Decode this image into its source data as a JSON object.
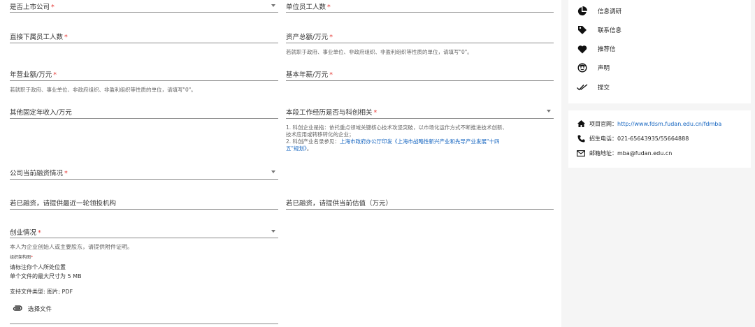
{
  "form": {
    "listed_company": {
      "label": "是否上市公司",
      "required": "*"
    },
    "unit_employees": {
      "label": "单位员工人数",
      "required": "*"
    },
    "direct_reports": {
      "label": "直接下属员工人数",
      "required": "*"
    },
    "total_assets": {
      "label": "资产总额/万元",
      "required": "*",
      "hint": "若就职于政府、事业单位、非政府组织、非盈利组织等性质的单位，请填写\"0\"。"
    },
    "annual_revenue": {
      "label": "年营业额/万元",
      "required": "*",
      "hint": "若就职于政府、事业单位、非政府组织、非盈利组织等性质的单位，请填写\"0\"。"
    },
    "base_salary": {
      "label": "基本年薪/万元",
      "required": "*"
    },
    "other_income": {
      "label": "其他固定年收入/万元"
    },
    "tech_related": {
      "label": "本段工作经历是否与科创相关",
      "required": "*",
      "hint_line1": "1. 科创企业是指：依托重点领域关键核心技术攻坚突破，以市场化运作方式不断推进技术创新、",
      "hint_line2": "技术应用或转移转化的企业；",
      "hint_line3_prefix": "2. 科创产业名录参见：",
      "hint_line3_link": "上海市政府办公厅印发《上海市战略性新兴产业和先导产业发展\"十四",
      "hint_line4_link": "五\"规划》",
      "hint_line4_suffix": "。"
    },
    "financing": {
      "label": "公司当前融资情况",
      "required": "*"
    },
    "lead_investor": {
      "label": "若已融资，请提供最近一轮领投机构"
    },
    "valuation": {
      "label": "若已融资，请提供当前估值（万元）"
    },
    "startup": {
      "label": "创业情况",
      "required": "*",
      "hint": "本人为企业创始人或主要股东，请提供附件证明。"
    },
    "org_chart": {
      "label": "组织架构图",
      "required": "*",
      "note1": "请标注你个人所处位置",
      "note2": "单个文件的最大尺寸为 5 MB",
      "note3": "支持文件类型: 图片; PDF",
      "upload_label": "选择文件"
    }
  },
  "nav": {
    "items": [
      {
        "label": "信息调研",
        "icon": "pie-chart-icon"
      },
      {
        "label": "联系信息",
        "icon": "tag-icon"
      },
      {
        "label": "推荐信",
        "icon": "heart-icon"
      },
      {
        "label": "声明",
        "icon": "face-icon"
      },
      {
        "label": "提交",
        "icon": "double-check-icon"
      }
    ]
  },
  "contact": {
    "website_label": "项目官网：",
    "website": "http://www.fdsm.fudan.edu.cn/fdmba",
    "phone_label": "招生电话：",
    "phone": "021-65643935/55664888",
    "email_label": "邮箱地址：",
    "email": "mba@fudan.edu.cn"
  },
  "colors": {
    "required": "#e53935",
    "link": "#1565c0",
    "sidebar_bg": "#f5f5f5"
  }
}
